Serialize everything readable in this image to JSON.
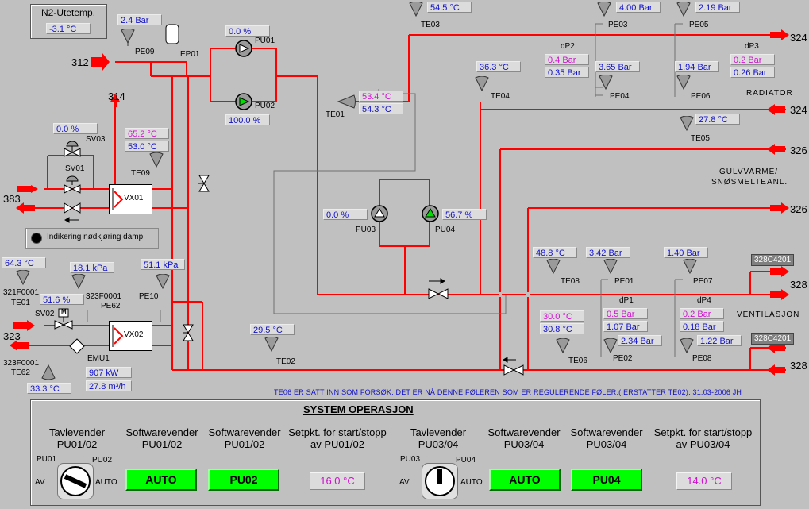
{
  "n2": {
    "title": "N2-Utetemp.",
    "value": "-3.1 °C"
  },
  "pipe_labels": {
    "p312": "312",
    "p314": "314",
    "p383": "383",
    "p323": "323",
    "p324a": "324",
    "p324b": "324",
    "p326a": "326",
    "p326b": "326",
    "p328a": "328",
    "p328b": "328"
  },
  "tags": {
    "pe09": "PE09",
    "ep01": "EP01",
    "pu01": "PU01",
    "pu02": "PU02",
    "te01": "TE01",
    "te03": "TE03",
    "te04": "TE04",
    "pe03": "PE03",
    "pe04": "PE04",
    "pe05": "PE05",
    "pe06": "PE06",
    "te05": "TE05",
    "sv03": "SV03",
    "sv01": "SV01",
    "te09": "TE09",
    "vx01": "VX01",
    "pu03": "PU03",
    "pu04": "PU04",
    "te08": "TE08",
    "pe01": "PE01",
    "pe07": "PE07",
    "pe02": "PE02",
    "pe08": "PE08",
    "te06": "TE06",
    "te02": "TE02",
    "pe10": "PE10",
    "vx02": "VX02",
    "emu1": "EMU1",
    "sv02": "SV02",
    "te01b": "TE01",
    "te01b_pre": "321F0001",
    "te62": "TE62",
    "te62_pre": "323F0001",
    "pe62": "PE62",
    "pe62_pre": "323F0001",
    "dp1": "dP1",
    "dp2": "dP2",
    "dp3": "dP3",
    "dp4": "dP4",
    "c1": "328C4201",
    "c2": "328C4201"
  },
  "values": {
    "pe09": "2.4 Bar",
    "pu01": "0.0 %",
    "pu02": "100.0 %",
    "te01_set": "53.4 °C",
    "te01": "54.3 °C",
    "te03": "54.5 °C",
    "te04": "36.3 °C",
    "pe03": "4.00 Bar",
    "pe04": "3.65 Bar",
    "dp2_set": "0.4 Bar",
    "dp2": "0.35 Bar",
    "pe05": "2.19 Bar",
    "pe06": "1.94 Bar",
    "dp3_set": "0.2 Bar",
    "dp3": "0.26 Bar",
    "te05": "27.8 °C",
    "sv03": "0.0 %",
    "te09_set": "65.2 °C",
    "te09": "53.0 °C",
    "pu03": "0.0 %",
    "pu04": "56.7 %",
    "te08": "48.8 °C",
    "pe01": "3.42 Bar",
    "pe07": "1.40 Bar",
    "dp1_set": "0.5 Bar",
    "dp1": "1.07 Bar",
    "pe02": "2.34 Bar",
    "dp4_set": "0.2 Bar",
    "dp4": "0.18 Bar",
    "pe08": "1.22 Bar",
    "te06_set": "30.0 °C",
    "te06": "30.8 °C",
    "te02": "29.5 °C",
    "te01b": "64.3 °C",
    "pe62": "18.1 kPa",
    "pe10": "51.1 kPa",
    "sv02": "51.6 %",
    "te62": "33.3 °C",
    "emu_power": "907 kW",
    "emu_flow": "27.8 m³/h"
  },
  "section_labels": {
    "radiator": "RADIATOR",
    "gulv1": "GULVVARME/",
    "gulv2": "SNØSMELTEANL.",
    "vent": "VENTILASJON",
    "sv02_m": "M"
  },
  "indicator": {
    "label": "Indikering nødkjøring damp"
  },
  "note": "TE06 ER SATT INN SOM FORSØK. DET ER NÅ DENNE FØLEREN SOM ER REGULERENDE FØLER.( ERSTATTER TE02). 31.03-2006 JH",
  "system": {
    "title": "SYSTEM OPERASJON",
    "col1": {
      "l1": "Tavlevender",
      "l2": "PU01/02"
    },
    "col2": {
      "l1": "Softwarevender",
      "l2": "PU01/02"
    },
    "col3": {
      "l1": "Softwarevender",
      "l2": "PU01/02"
    },
    "col4": {
      "l1": "Setpkt. for start/stopp",
      "l2": "av PU01/02"
    },
    "col5": {
      "l1": "Tavlevender",
      "l2": "PU03/04"
    },
    "col6": {
      "l1": "Softwarevender",
      "l2": "PU03/04"
    },
    "col7": {
      "l1": "Softwarevender",
      "l2": "PU03/04"
    },
    "col8": {
      "l1": "Setpkt. for start/stopp",
      "l2": "av PU03/04"
    },
    "sw1": {
      "left_top": "PU01",
      "right_top": "PU02",
      "left": "AV",
      "right": "AUTO"
    },
    "sw2": {
      "left_top": "PU03",
      "right_top": "PU04",
      "left": "AV",
      "right": "AUTO"
    },
    "btn_auto1": "AUTO",
    "btn_pu02": "PU02",
    "setp1": "16.0 °C",
    "btn_auto2": "AUTO",
    "btn_pu04": "PU04",
    "setp2": "14.0 °C"
  },
  "colors": {
    "pipe": "#ff0000",
    "background": "#c0c0c0",
    "button_on": "#00ff00",
    "value_blue": "#1010c8",
    "setpoint_magenta": "#d010d0"
  }
}
